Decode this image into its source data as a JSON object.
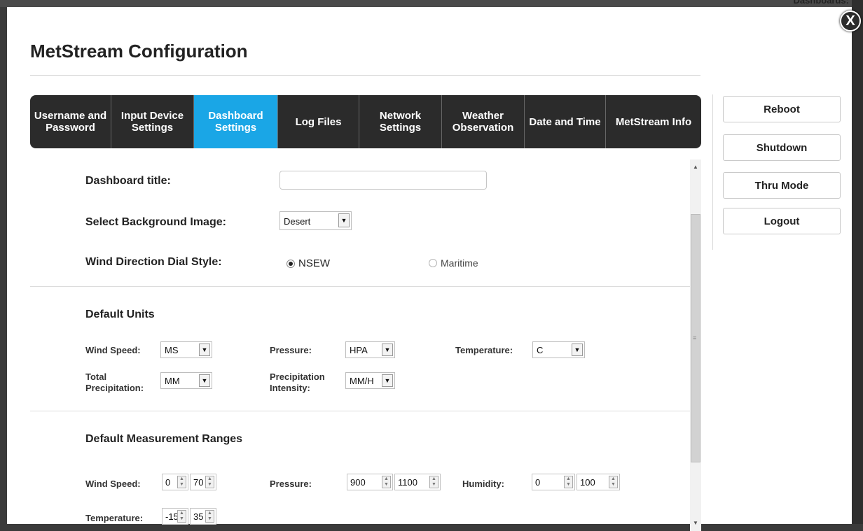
{
  "dashboards_label": "Dashboards:",
  "close_label": "X",
  "title": "MetStream Configuration",
  "tabs": [
    {
      "label": "Username and Password"
    },
    {
      "label": "Input Device Settings"
    },
    {
      "label": "Dashboard Settings",
      "active": true
    },
    {
      "label": "Log Files"
    },
    {
      "label": "Network Settings"
    },
    {
      "label": "Weather Observation"
    },
    {
      "label": "Date and Time"
    },
    {
      "label": "MetStream Info"
    }
  ],
  "side_buttons": {
    "reboot": "Reboot",
    "shutdown": "Shutdown",
    "thru_mode": "Thru Mode",
    "logout": "Logout"
  },
  "dashboard": {
    "title_label": "Dashboard title:",
    "title_value": "",
    "bg_label": "Select Background Image:",
    "bg_value": "Desert",
    "dial_label": "Wind Direction Dial Style:",
    "dial_opt1": "NSEW",
    "dial_opt2": "Maritime",
    "dial_selected": "NSEW"
  },
  "units": {
    "heading": "Default Units",
    "wind_speed_label": "Wind Speed:",
    "wind_speed_value": "MS",
    "pressure_label": "Pressure:",
    "pressure_value": "HPA",
    "temperature_label": "Temperature:",
    "temperature_value": "C",
    "total_precip_label": "Total Precipitation:",
    "total_precip_value": "MM",
    "precip_intensity_label": "Precipitation Intensity:",
    "precip_intensity_value": "MM/H"
  },
  "ranges": {
    "heading": "Default Measurement Ranges",
    "wind_label": "Wind Speed:",
    "wind_min": "0",
    "wind_max": "70",
    "pressure_label": "Pressure:",
    "pressure_min": "900",
    "pressure_max": "1100",
    "humidity_label": "Humidity:",
    "humidity_min": "0",
    "humidity_max": "100",
    "temp_label": "Temperature:",
    "temp_min": "-15",
    "temp_max": "35"
  },
  "colors": {
    "active_tab": "#1aa6e6",
    "tab_bar": "#2b2b2b"
  }
}
